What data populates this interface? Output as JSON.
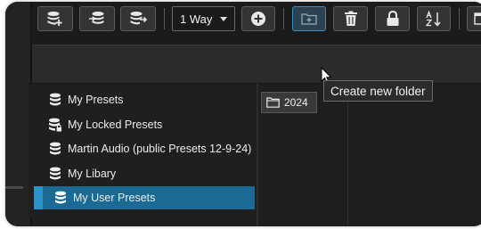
{
  "toolbar": {
    "buttons": [
      {
        "icon": "database-add-icon"
      },
      {
        "icon": "database-import-icon"
      },
      {
        "icon": "database-export-icon"
      },
      {
        "icon": "add-circle-icon"
      },
      {
        "icon": "new-folder-icon"
      },
      {
        "icon": "trash-icon"
      },
      {
        "icon": "lock-icon"
      },
      {
        "icon": "sort-az-icon"
      }
    ],
    "way_select": {
      "value": "1 Way"
    }
  },
  "tooltip": {
    "text": "Create new folder"
  },
  "sidebar": {
    "items": [
      {
        "label": "My Presets",
        "icon": "database-icon"
      },
      {
        "label": "My Locked Presets",
        "icon": "database-lock-icon"
      },
      {
        "label": "Martin Audio (public Presets 12-9-24)",
        "icon": "database-icon"
      },
      {
        "label": "My Libary",
        "icon": "database-icon"
      },
      {
        "label": "My User Presets",
        "icon": "database-icon",
        "selected": true
      }
    ]
  },
  "folders": [
    {
      "label": "2024",
      "icon": "folder-icon"
    }
  ],
  "colors": {
    "selected": "#1b6a93",
    "accent": "#2a93c8",
    "active_button_border": "#3e8fbf"
  }
}
